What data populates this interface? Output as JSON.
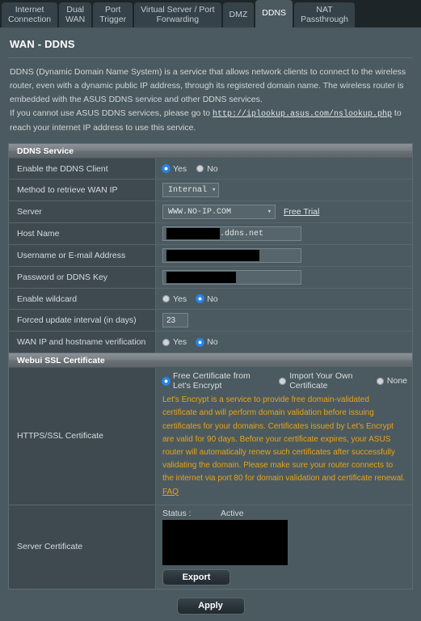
{
  "tabs": [
    {
      "label": "Internet\nConnection",
      "active": false
    },
    {
      "label": "Dual\nWAN",
      "active": false
    },
    {
      "label": "Port\nTrigger",
      "active": false
    },
    {
      "label": "Virtual Server / Port\nForwarding",
      "active": false
    },
    {
      "label": "DMZ",
      "active": false
    },
    {
      "label": "DDNS",
      "active": true
    },
    {
      "label": "NAT\nPassthrough",
      "active": false
    }
  ],
  "page": {
    "title": "WAN - DDNS",
    "description_part1": "DDNS (Dynamic Domain Name System) is a service that allows network clients to connect to the wireless router, even with a dynamic public IP address, through its registered domain name. The wireless router is embedded with the ASUS DDNS service and other DDNS services.",
    "description_part2_pre": "If you cannot use ASUS DDNS services, please go to ",
    "description_link": "http://iplookup.asus.com/nslookup.php",
    "description_part2_post": " to reach your internet IP address to use this service."
  },
  "ddns_service": {
    "header": "DDNS Service",
    "enable_client": {
      "label": "Enable the DDNS Client",
      "yes_label": "Yes",
      "no_label": "No",
      "selected": "Yes"
    },
    "method_wan_ip": {
      "label": "Method to retrieve WAN IP",
      "value": "Internal"
    },
    "server": {
      "label": "Server",
      "value": "WWW.NO-IP.COM",
      "free_trial_label": "Free Trial"
    },
    "host_name": {
      "label": "Host Name",
      "value": "",
      "suffix": ".ddns.net"
    },
    "username": {
      "label": "Username or E-mail Address",
      "value": ""
    },
    "password": {
      "label": "Password or DDNS Key",
      "value": ""
    },
    "enable_wildcard": {
      "label": "Enable wildcard",
      "yes_label": "Yes",
      "no_label": "No",
      "selected": "No"
    },
    "forced_update": {
      "label": "Forced update interval (in days)",
      "value": "23"
    },
    "wan_ip_verification": {
      "label": "WAN IP and hostname verification",
      "yes_label": "Yes",
      "no_label": "No",
      "selected": "No"
    }
  },
  "ssl_section": {
    "header": "Webui SSL Certificate",
    "https_ssl": {
      "label": "HTTPS/SSL Certificate",
      "option_free": "Free Certificate from Let's Encrypt",
      "option_import": "Import Your Own Certificate",
      "option_none": "None",
      "selected": "Free Certificate from Let's Encrypt",
      "note": "Let's Encrypt is a service to provide free domain-validated certificate and will perform domain validation before issuing certificates for your domains. Certificates issued by Let's Encrypt are valid for 90 days. Before your certificate expires, your ASUS router will automatically renew such certificates after successfully validating the domain. Please make sure your router connects to the internet via port 80 for domain validation and certificate renewal. ",
      "faq_label": "FAQ"
    },
    "server_certificate": {
      "label": "Server Certificate",
      "status_key": "Status :",
      "status_value": "Active",
      "export_label": "Export"
    }
  },
  "footer": {
    "apply_label": "Apply"
  },
  "colors": {
    "panel_bg": "#4b5a60",
    "label_bg": "#3e4a50",
    "outer_bg": "#1d2529",
    "radio_accent": "#1e7fe0",
    "note_orange": "#e8a317",
    "redaction": "#000000"
  }
}
